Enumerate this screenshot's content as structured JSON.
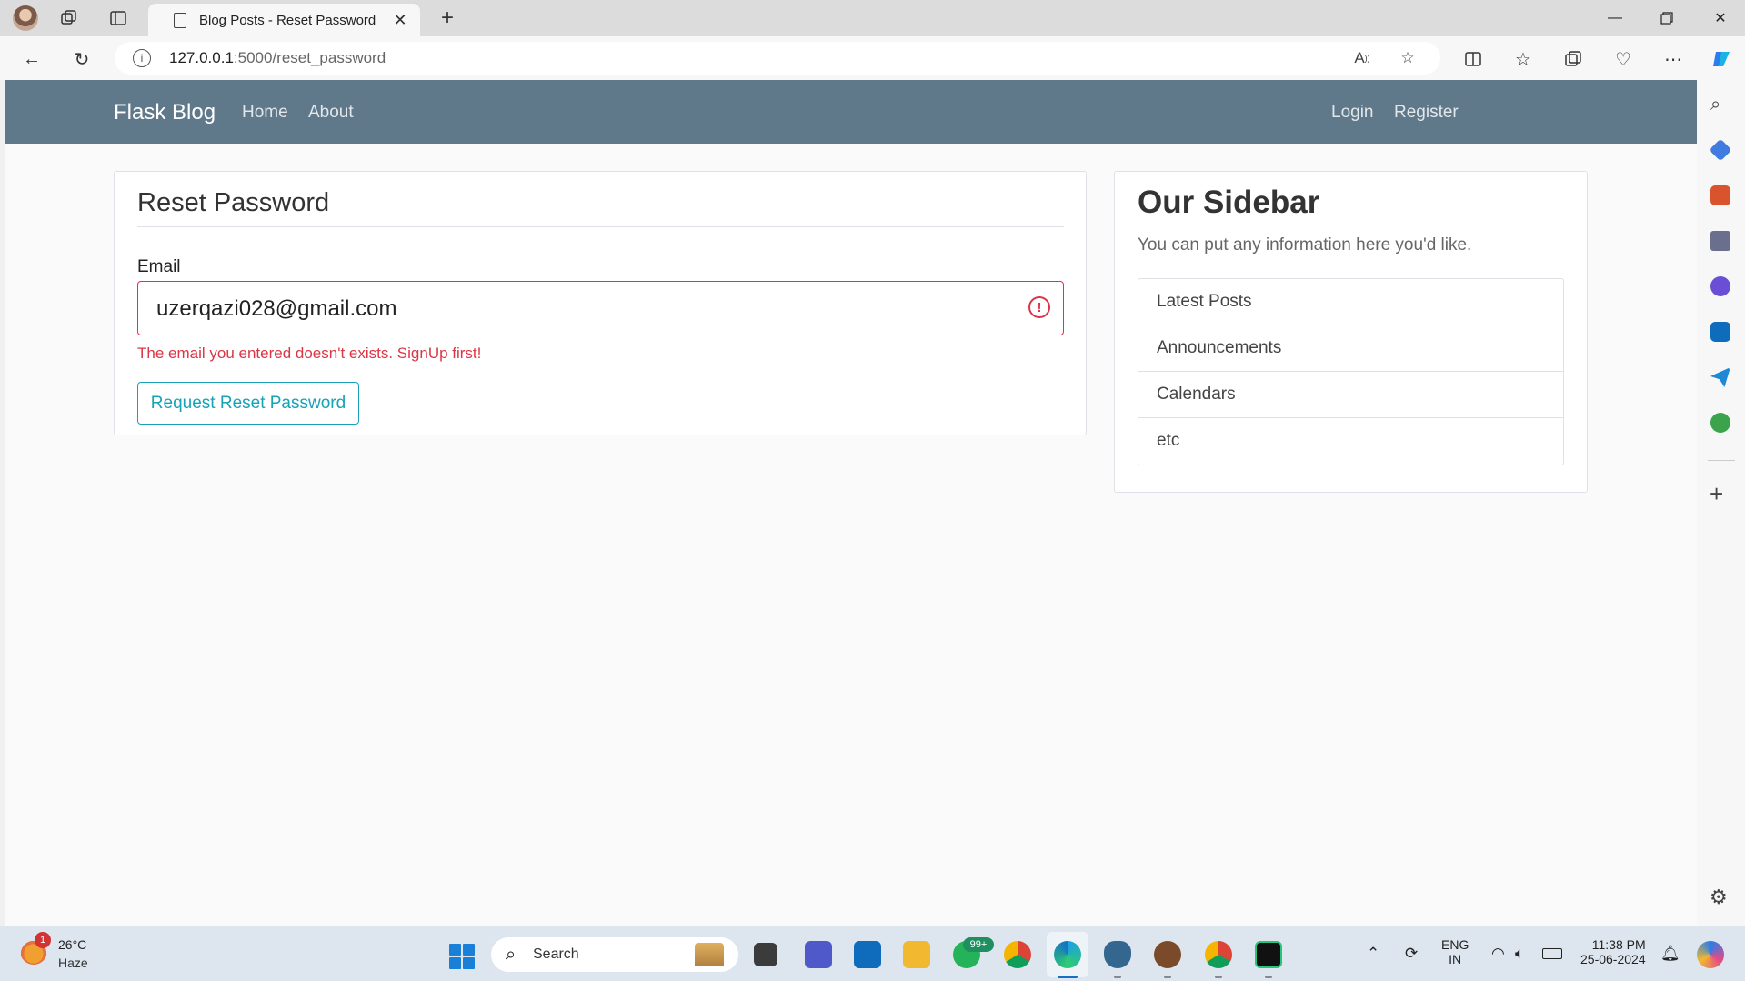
{
  "browser": {
    "tab_title": "Blog Posts - Reset Password",
    "url_host": "127.0.0.1",
    "url_path": ":5000/reset_password"
  },
  "navbar": {
    "brand": "Flask Blog",
    "left_links": [
      "Home",
      "About"
    ],
    "right_links": [
      "Login",
      "Register"
    ]
  },
  "form": {
    "legend": "Reset Password",
    "email_label": "Email",
    "email_value": "uzerqazi028@gmail.com",
    "error_message": "The email you entered doesn't exists. SignUp first!",
    "submit_label": "Request Reset Password"
  },
  "sidebar": {
    "title": "Our Sidebar",
    "text": "You can put any information here you'd like.",
    "items": [
      "Latest Posts",
      "Announcements",
      "Calendars",
      "etc"
    ]
  },
  "taskbar": {
    "weather_temp": "26°C",
    "weather_condition": "Haze",
    "weather_badge": "1",
    "search_placeholder": "Search",
    "whatsapp_badge": "99+",
    "language_line1": "ENG",
    "language_line2": "IN",
    "time": "11:38 PM",
    "date": "25-06-2024"
  },
  "colors": {
    "navbar": "#5f788a",
    "error": "#dc3545",
    "button_outline": "#17a2b8"
  }
}
